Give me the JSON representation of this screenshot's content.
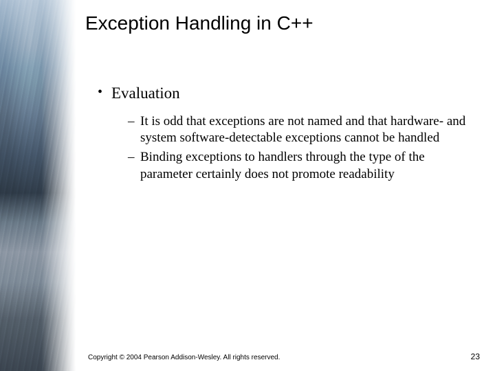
{
  "title": "Exception Handling in C++",
  "bullets": {
    "level1": [
      {
        "text": "Evaluation",
        "children": [
          "It is odd that exceptions are not named and that hardware- and system software-detectable exceptions cannot be handled",
          "Binding exceptions to handlers through the type of the parameter certainly does not promote readability"
        ]
      }
    ]
  },
  "footer": {
    "copyright": "Copyright © 2004 Pearson Addison-Wesley. All rights reserved.",
    "page_number": "23"
  }
}
